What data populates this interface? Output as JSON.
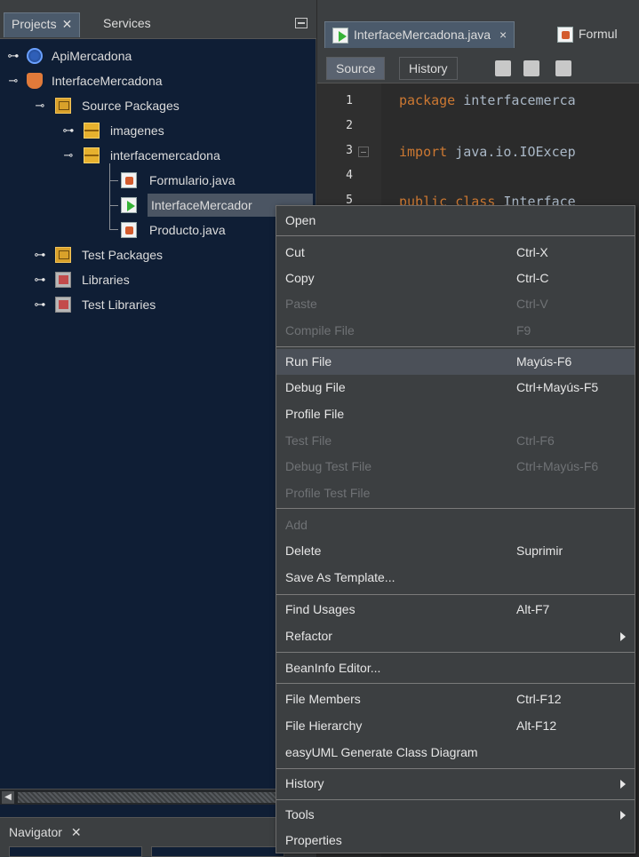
{
  "left_panel": {
    "tabs": [
      {
        "label": "Projects",
        "close": "✕"
      },
      {
        "label": "Services"
      }
    ],
    "tree": [
      {
        "label": "ApiMercadona"
      },
      {
        "label": "InterfaceMercadona"
      },
      {
        "label": "Source Packages"
      },
      {
        "label": "imagenes"
      },
      {
        "label": "interfacemercadona"
      },
      {
        "label": "Formulario.java"
      },
      {
        "label": "InterfaceMercador"
      },
      {
        "label": "Producto.java"
      },
      {
        "label": "Test Packages"
      },
      {
        "label": "Libraries"
      },
      {
        "label": "Test Libraries"
      }
    ],
    "navigator": {
      "label": "Navigator",
      "close": "✕"
    }
  },
  "editor": {
    "tabs": [
      {
        "label": "InterfaceMercadona.java",
        "close": "×"
      },
      {
        "label": "Formul"
      }
    ],
    "toolbar": {
      "source": "Source",
      "history": "History"
    },
    "lines": [
      {
        "num": "1",
        "kw": "package",
        "text": " interfacemerca"
      },
      {
        "num": "2",
        "kw": "",
        "text": ""
      },
      {
        "num": "3",
        "kw": "import",
        "text": " java.io.IOExcep"
      },
      {
        "num": "4",
        "kw": "",
        "text": ""
      },
      {
        "num": "5",
        "kw": "public class",
        "text": " Interface"
      }
    ]
  },
  "context_menu": {
    "items": [
      {
        "label": "Open",
        "shortcut": ""
      },
      {
        "label": "Cut",
        "shortcut": "Ctrl-X"
      },
      {
        "label": "Copy",
        "shortcut": "Ctrl-C"
      },
      {
        "label": "Paste",
        "shortcut": "Ctrl-V"
      },
      {
        "label": "Compile File",
        "shortcut": "F9"
      },
      {
        "label": "Run File",
        "shortcut": "Mayús-F6"
      },
      {
        "label": "Debug File",
        "shortcut": "Ctrl+Mayús-F5"
      },
      {
        "label": "Profile File",
        "shortcut": ""
      },
      {
        "label": "Test File",
        "shortcut": "Ctrl-F6"
      },
      {
        "label": "Debug Test File",
        "shortcut": "Ctrl+Mayús-F6"
      },
      {
        "label": "Profile Test File",
        "shortcut": ""
      },
      {
        "label": "Add",
        "shortcut": ""
      },
      {
        "label": "Delete",
        "shortcut": "Suprimir"
      },
      {
        "label": "Save As Template...",
        "shortcut": ""
      },
      {
        "label": "Find Usages",
        "shortcut": "Alt-F7"
      },
      {
        "label": "Refactor",
        "shortcut": ""
      },
      {
        "label": "BeanInfo Editor...",
        "shortcut": ""
      },
      {
        "label": "File Members",
        "shortcut": "Ctrl-F12"
      },
      {
        "label": "File Hierarchy",
        "shortcut": "Alt-F12"
      },
      {
        "label": "easyUML Generate Class Diagram",
        "shortcut": ""
      },
      {
        "label": "History",
        "shortcut": ""
      },
      {
        "label": "Tools",
        "shortcut": ""
      },
      {
        "label": "Properties",
        "shortcut": ""
      }
    ]
  }
}
